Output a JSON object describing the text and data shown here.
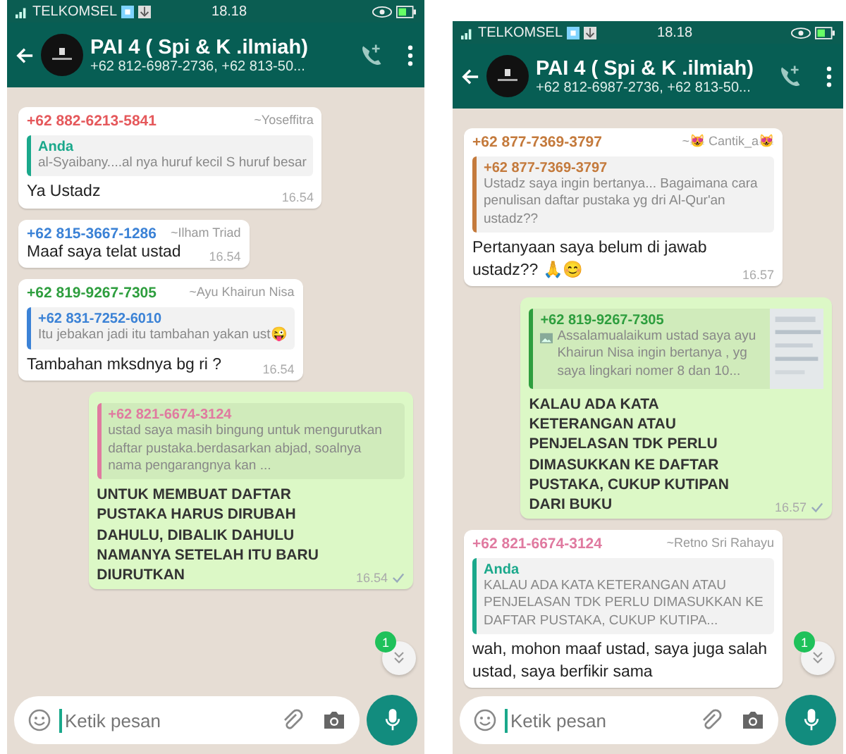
{
  "phones": [
    {
      "status_bar": {
        "carrier": "TELKOMSEL",
        "time": "18.18"
      },
      "header": {
        "title": "PAI 4 ( Spi & K .ilmiah)",
        "subtitle": "+62 812-6987-2736, +62 813-50..."
      },
      "messages": [
        {
          "kind": "incoming",
          "sender": "+62 882-6213-5841",
          "color": "#e5585b",
          "author": "~Yoseffitra",
          "quote": {
            "sender": "Anda",
            "color": "#1aa88b",
            "text": "al-Syaibany....al nya huruf kecil S huruf besar"
          },
          "text": "Ya Ustadz",
          "time": "16.54"
        },
        {
          "kind": "incoming",
          "sender": "+62 815-3667-1286",
          "color": "#3b82d6",
          "author": "~Ilham Triad",
          "text": "Maaf saya telat ustad",
          "time": "16.54"
        },
        {
          "kind": "incoming",
          "sender": "+62 819-9267-7305",
          "color": "#2e9e3e",
          "author": "~Ayu Khairun Nisa",
          "quote": {
            "sender": "+62 831-7252-6010",
            "color": "#3b82d6",
            "text": "Itu jebakan jadi itu tambahan yakan ust😜"
          },
          "text": "Tambahan mksdnya bg ri ?",
          "time": "16.54"
        },
        {
          "kind": "outgoing",
          "quote": {
            "sender": "+62 821-6674-3124",
            "color": "#e07aa0",
            "text": "ustad saya masih bingung untuk mengurutkan daftar pustaka.berdasarkan abjad, soalnya nama pengarangnya kan ..."
          },
          "text": "UNTUK MEMBUAT DAFTAR PUSTAKA HARUS DIRUBAH DAHULU, DIBALIK DAHULU NAMANYA SETELAH ITU BARU DIURUTKAN",
          "time": "16.54",
          "tick": true
        }
      ],
      "unread_badge": "1",
      "input": {
        "placeholder": "Ketik pesan"
      }
    },
    {
      "status_bar": {
        "carrier": "TELKOMSEL",
        "time": "18.18"
      },
      "header": {
        "title": "PAI 4 ( Spi & K .ilmiah)",
        "subtitle": "+62 812-6987-2736, +62 813-50..."
      },
      "messages": [
        {
          "kind": "incoming",
          "sender": "+62 877-7369-3797",
          "color": "#c47a3c",
          "author": "~😻 Cantik_a😻",
          "quote": {
            "sender": "+62 877-7369-3797",
            "color": "#c47a3c",
            "text": "Ustadz saya ingin bertanya... Bagaimana cara penulisan daftar pustaka yg dri Al-Qur'an ustadz??"
          },
          "text": "Pertanyaan saya belum di jawab ustadz?? 🙏😊",
          "time": "16.57"
        },
        {
          "kind": "outgoing",
          "quote": {
            "sender": "+62 819-9267-7305",
            "color": "#2e9e3e",
            "text": "Assalamualaikum ustad saya ayu Khairun Nisa ingin bertanya , yg saya lingkari nomer 8 dan 10...",
            "thumbnail": true
          },
          "text": "KALAU ADA KATA KETERANGAN ATAU PENJELASAN TDK PERLU DIMASUKKAN KE DAFTAR PUSTAKA, CUKUP KUTIPAN DARI  BUKU",
          "time": "16.57",
          "tick": true
        },
        {
          "kind": "incoming",
          "sender": "+62 821-6674-3124",
          "color": "#e07aa0",
          "author": "~Retno Sri Rahayu",
          "quote": {
            "sender": "Anda",
            "color": "#1aa88b",
            "text": "KALAU ADA KATA KETERANGAN ATAU PENJELASAN TDK PERLU DIMASUKKAN KE DAFTAR PUSTAKA, CUKUP KUTIPA..."
          },
          "text": "wah, mohon maaf ustad, saya juga salah ustad, saya berfikir sama"
        }
      ],
      "unread_badge": "1",
      "input": {
        "placeholder": "Ketik pesan"
      }
    }
  ]
}
